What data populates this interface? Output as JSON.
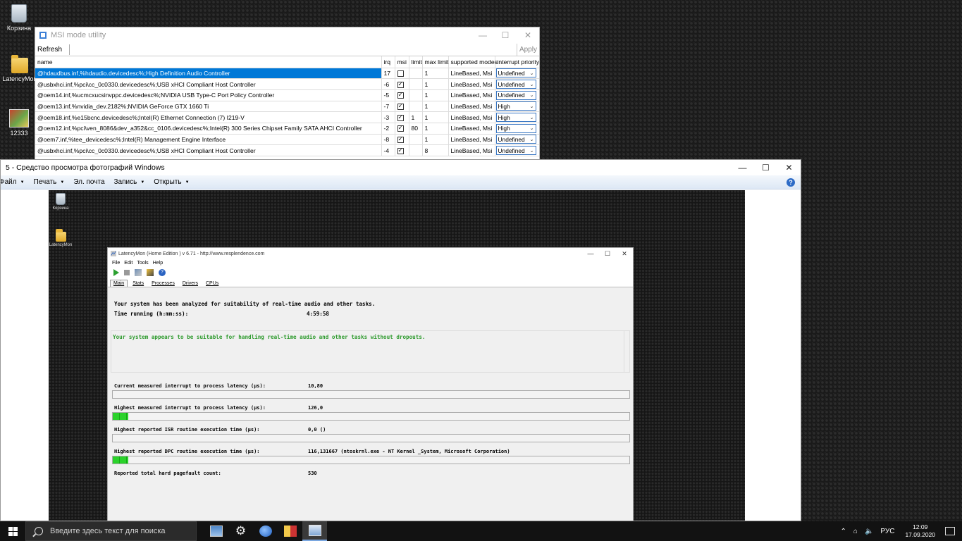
{
  "desktop": {
    "icons": [
      {
        "label": "Корзина"
      },
      {
        "label": "LatencyMon"
      },
      {
        "label": "12333"
      }
    ]
  },
  "msi_window": {
    "title": "MSI mode utility",
    "refresh_label": "Refresh",
    "apply_label": "Apply",
    "columns": [
      "name",
      "irq",
      "msi",
      "limit",
      "max limit",
      "supported modes",
      "interrupt priority"
    ],
    "rows": [
      {
        "name": "@hdaudbus.inf,%hdaudio.devicedesc%;High Definition Audio Controller",
        "irq": "17",
        "msi": false,
        "limit": "",
        "max_limit": "1",
        "modes": "LineBased, Msi",
        "priority": "Undefined",
        "selected": true
      },
      {
        "name": "@usbxhci.inf,%pci\\cc_0c0330.devicedesc%;USB xHCI Compliant Host Controller",
        "irq": "-6",
        "msi": true,
        "limit": "",
        "max_limit": "1",
        "modes": "LineBased, Msi",
        "priority": "Undefined",
        "selected": false
      },
      {
        "name": "@oem14.inf,%ucmcxucsinvppc.devicedesc%;NVIDIA USB Type-C Port Policy Controller",
        "irq": "-5",
        "msi": true,
        "limit": "",
        "max_limit": "1",
        "modes": "LineBased, Msi",
        "priority": "Undefined",
        "selected": false
      },
      {
        "name": "@oem13.inf,%nvidia_dev.2182%;NVIDIA GeForce GTX 1660 Ti",
        "irq": "-7",
        "msi": true,
        "limit": "",
        "max_limit": "1",
        "modes": "LineBased, Msi",
        "priority": "High",
        "selected": false
      },
      {
        "name": "@oem18.inf,%e15bcnc.devicedesc%;Intel(R) Ethernet Connection (7) I219-V",
        "irq": "-3",
        "msi": true,
        "limit": "1",
        "max_limit": "1",
        "modes": "LineBased, Msi",
        "priority": "High",
        "selected": false
      },
      {
        "name": "@oem12.inf,%pci\\ven_8086&dev_a352&cc_0106.devicedesc%;Intel(R) 300 Series Chipset Family SATA AHCI Controller",
        "irq": "-2",
        "msi": true,
        "limit": "80",
        "max_limit": "1",
        "modes": "LineBased, Msi",
        "priority": "High",
        "selected": false
      },
      {
        "name": "@oem7.inf,%tee_devicedesc%;Intel(R) Management Engine Interface",
        "irq": "-8",
        "msi": true,
        "limit": "",
        "max_limit": "1",
        "modes": "LineBased, Msi",
        "priority": "Undefined",
        "selected": false
      },
      {
        "name": "@usbxhci.inf,%pci\\cc_0c0330.devicedesc%;USB xHCI Compliant Host Controller",
        "irq": "-4",
        "msi": true,
        "limit": "",
        "max_limit": "8",
        "modes": "LineBased, Msi",
        "priority": "Undefined",
        "selected": false
      }
    ]
  },
  "viewer": {
    "title": "5 - Средство просмотра фотографий Windows",
    "menu": [
      {
        "label": "Файл",
        "dropdown": true
      },
      {
        "label": "Печать",
        "dropdown": true
      },
      {
        "label": "Эл. почта",
        "dropdown": false
      },
      {
        "label": "Запись",
        "dropdown": true
      },
      {
        "label": "Открыть",
        "dropdown": true
      }
    ],
    "help_glyph": "?",
    "photo_icons": [
      {
        "label": "Корзина"
      },
      {
        "label": "LatencyMon"
      }
    ]
  },
  "latencymon": {
    "title": "LatencyMon  (Home Edition )  v 6.71 - http://www.resplendence.com",
    "menu": [
      "File",
      "Edit",
      "Tools",
      "Help"
    ],
    "tabs": [
      "Main",
      "Stats",
      "Processes",
      "Drivers",
      "CPUs"
    ],
    "active_tab": "Main",
    "analysis_line": "Your system has been analyzed for suitability of real-time audio and other tasks.",
    "time_label": "Time running (h:mm:ss):",
    "time_value": "4:59:58",
    "verdict": "Your system appears to be suitable for handling real-time audio and other tasks without dropouts.",
    "metrics": [
      {
        "label": "Current measured interrupt to process latency (µs):",
        "value": "10,80",
        "bar_fraction": 0.0
      },
      {
        "label": "Highest measured interrupt to process latency (µs):",
        "value": "126,0",
        "bar_fraction": 0.03
      },
      {
        "label": "Highest reported ISR routine execution time (µs):",
        "value": "0,0  ()",
        "bar_fraction": 0.0
      },
      {
        "label": "Highest reported DPC routine execution time (µs):",
        "value": "116,131667   (ntoskrnl.exe - NT Kernel _System, Microsoft Corporation)",
        "bar_fraction": 0.03
      },
      {
        "label": "Reported total hard pagefault count:",
        "value": "530",
        "bar_fraction": null
      }
    ]
  },
  "taskbar": {
    "search_placeholder": "Введите здесь текст для поиска",
    "language": "РУС",
    "time": "12:09",
    "date": "17.09.2020"
  }
}
